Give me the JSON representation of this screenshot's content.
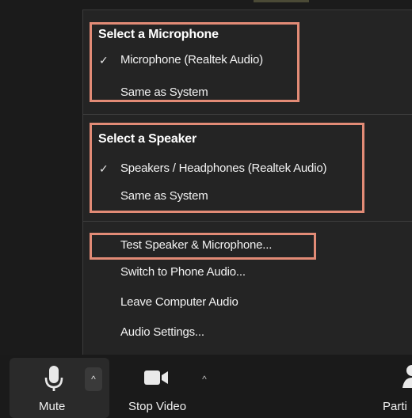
{
  "menu": {
    "microphone_section": {
      "heading": "Select a Microphone",
      "items": [
        {
          "label": "Microphone (Realtek Audio)",
          "checked": true
        },
        {
          "label": "Same as System",
          "checked": false
        }
      ]
    },
    "speaker_section": {
      "heading": "Select a Speaker",
      "items": [
        {
          "label": "Speakers / Headphones (Realtek Audio)",
          "checked": true
        },
        {
          "label": "Same as System",
          "checked": false
        }
      ]
    },
    "actions": [
      {
        "label": "Test Speaker & Microphone..."
      },
      {
        "label": "Switch to Phone Audio..."
      },
      {
        "label": "Leave Computer Audio"
      },
      {
        "label": "Audio Settings..."
      }
    ],
    "check_glyph": "✓"
  },
  "toolbar": {
    "mute_label": "Mute",
    "stop_video_label": "Stop Video",
    "participants_label": "Parti",
    "caret_glyph": "^"
  },
  "colors": {
    "menu_bg": "#242424",
    "toolbar_bg": "#1a1a1a",
    "highlight": "#e28b76",
    "text": "#f2f2f2"
  },
  "icons": {
    "microphone": "microphone-icon",
    "video": "video-camera-icon",
    "participants": "participants-icon",
    "check": "checkmark-icon",
    "caret": "caret-up-icon"
  }
}
